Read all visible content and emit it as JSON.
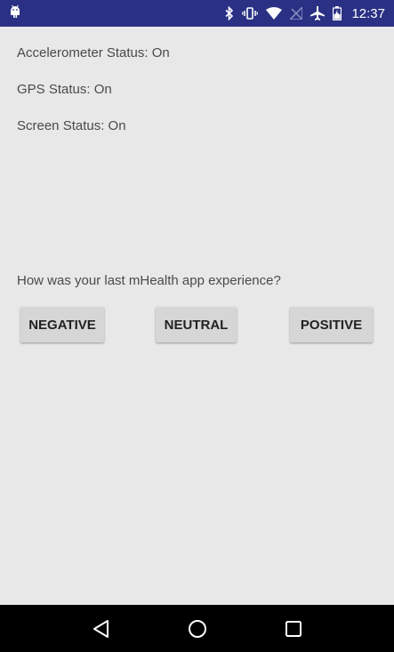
{
  "status_bar": {
    "time": "12:37",
    "icons": [
      "android-icon",
      "bluetooth-icon",
      "vibrate-icon",
      "wifi-icon",
      "signal-off-icon",
      "airplane-icon",
      "battery-charging-icon"
    ],
    "background": "#2a3184"
  },
  "statuses": [
    {
      "text": "Accelerometer Status: On"
    },
    {
      "text": "GPS Status: On"
    },
    {
      "text": "Screen Status: On"
    }
  ],
  "survey": {
    "question": "How was your last mHealth app experience?",
    "buttons": [
      {
        "label": "NEGATIVE"
      },
      {
        "label": "NEUTRAL"
      },
      {
        "label": "POSITIVE"
      }
    ]
  },
  "nav_bar": {
    "icons": [
      "back-icon",
      "home-icon",
      "recents-icon"
    ]
  }
}
